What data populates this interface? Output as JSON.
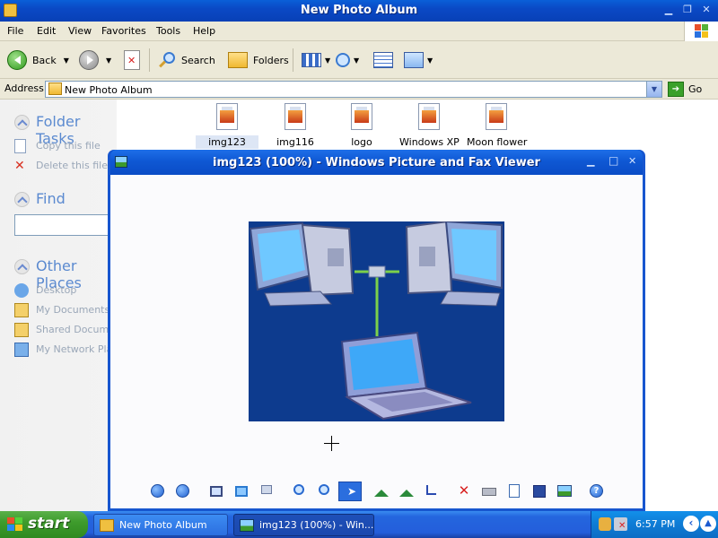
{
  "explorer": {
    "title": "New Photo Album",
    "menu": [
      "File",
      "Edit",
      "View",
      "Favorites",
      "Tools",
      "Help"
    ],
    "toolbar": {
      "back_label": "Back",
      "search_label": "Search",
      "folders_label": "Folders"
    },
    "address": {
      "label": "Address",
      "value": "New Photo Album",
      "go_label": "Go"
    },
    "taskpane": {
      "folder_tasks": {
        "title": "Folder Tasks",
        "items": [
          "Copy this file",
          "Delete this file"
        ]
      },
      "find": {
        "title": "Find"
      },
      "other_places": {
        "title": "Other Places",
        "items": [
          "Desktop",
          "My Documents",
          "Shared Documents",
          "My Network Places"
        ]
      }
    },
    "files": [
      {
        "name": "img123",
        "selected": true
      },
      {
        "name": "img116",
        "selected": false
      },
      {
        "name": "logo",
        "selected": false
      },
      {
        "name": "Windows XP",
        "selected": false
      },
      {
        "name": "Moon flower",
        "selected": false
      }
    ]
  },
  "viewer": {
    "title": "img123 (100%) - Windows Picture and Fax Viewer",
    "photo_subject": "computer network illustration",
    "toolbar_icons": [
      "previous-image-icon",
      "next-image-icon",
      "best-fit-icon",
      "actual-size-icon",
      "slideshow-icon",
      "zoom-in-icon",
      "zoom-out-icon",
      "pointer-icon",
      "rotate-clockwise-icon",
      "rotate-counterclockwise-icon",
      "crop-icon",
      "delete-icon",
      "print-icon",
      "copy-to-icon",
      "save-icon",
      "edit-icon",
      "help-icon"
    ]
  },
  "taskbar": {
    "start_label": "start",
    "buttons": [
      "New Photo Album",
      "img123 (100%) - Win..."
    ],
    "clock": "6:57 PM"
  },
  "colors": {
    "xp_blue": "#0a49c5",
    "start_green": "#3e9c2c",
    "taskpane_link": "#5b8ad0"
  }
}
